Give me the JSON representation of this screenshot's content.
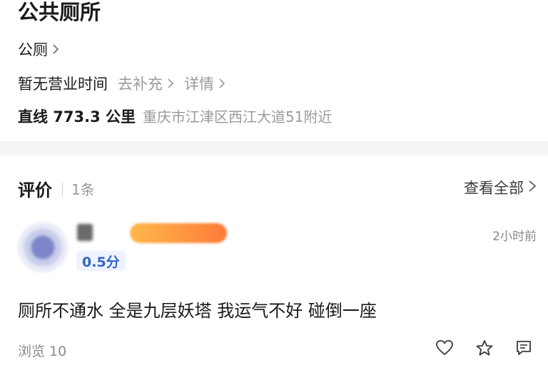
{
  "poi": {
    "name": "公共厕所",
    "category": "公厕",
    "hours": "暂无营业时间",
    "supplement_link": "去补充",
    "details_link": "详情",
    "distance": "直线 773.3 公里",
    "address": "重庆市江津区西江大道51附近"
  },
  "reviews": {
    "title": "评价",
    "count": "1条",
    "view_all": "查看全部",
    "items": [
      {
        "rating": "0.5分",
        "time": "2小时前",
        "text": "厕所不通水 全是九层妖塔 我运气不好 碰倒一座",
        "views": "浏览 10"
      }
    ]
  },
  "icons": {
    "chevron": "chevron-right-icon",
    "like": "heart-icon",
    "favorite": "star-icon",
    "comment": "comment-icon"
  }
}
